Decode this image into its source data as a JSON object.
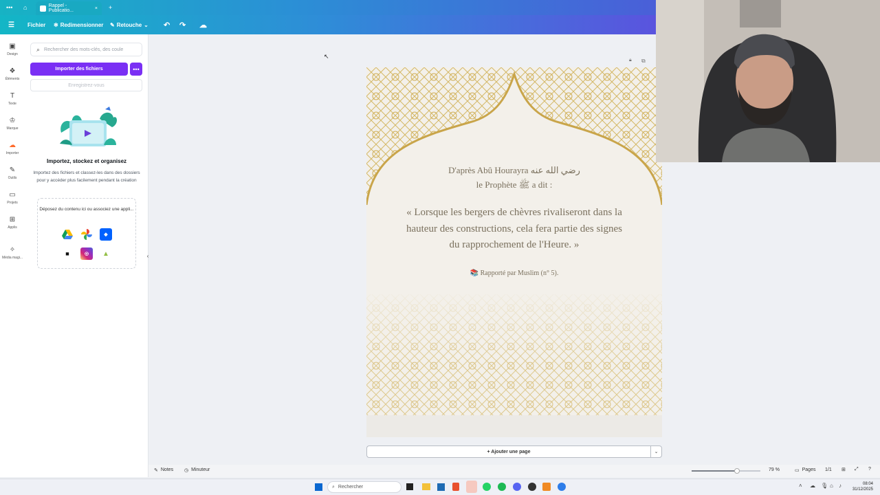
{
  "browser": {
    "tab_title": "Rappel - Publicatio...",
    "tab_close": "×",
    "new_tab": "+"
  },
  "toolbar": {
    "file": "Fichier",
    "resize": "Redimensionner",
    "edit": "Retouche"
  },
  "rail": {
    "items": [
      {
        "label": "Design",
        "icon": "layout-icon"
      },
      {
        "label": "Éléments",
        "icon": "shapes-icon"
      },
      {
        "label": "Texte",
        "icon": "text-icon"
      },
      {
        "label": "Marque",
        "icon": "brand-icon"
      },
      {
        "label": "Importer",
        "icon": "upload-cloud-icon"
      },
      {
        "label": "Outils",
        "icon": "pen-icon"
      },
      {
        "label": "Projets",
        "icon": "folder-icon"
      },
      {
        "label": "Applis",
        "icon": "apps-grid-icon"
      },
      {
        "label": "Média magi...",
        "icon": "magic-media-icon"
      }
    ]
  },
  "panel": {
    "search_placeholder": "Rechercher des mots-clés, des coule",
    "import_button": "Importer des fichiers",
    "record_button": "Enregistrez-vous",
    "title": "Importez, stockez et organisez",
    "description": "Importez des fichiers et classez-les dans des dossiers pour y accéder plus facilement pendant la création",
    "drop_text": "Déposez du contenu ici ou associez une appli...",
    "apps": [
      "Google Drive",
      "Google Photos",
      "Dropbox",
      "Notion",
      "Instagram",
      "Shopify"
    ]
  },
  "design": {
    "line1": "D'après Abû Hourayra رضي الله عنه",
    "line2": "le Prophète ﷺ a dit :",
    "quote1": "« Lorsque les bergers de chèvres rivaliseront dans la",
    "quote2": "hauteur des constructions, cela fera partie des signes",
    "quote3": "du rapprochement de l'Heure. »",
    "source": "📚 Rapporté par Muslim (n° 5)."
  },
  "canvas": {
    "add_page": "+ Ajouter une page"
  },
  "footer": {
    "notes": "Notes",
    "timer": "Minuteur",
    "zoom": "79 %",
    "zoom_fraction": 0.79,
    "pages_label": "Pages",
    "pages_count": "1/1"
  },
  "taskbar": {
    "search": "Rechercher",
    "time": "08:04",
    "date": "31/12/2025"
  },
  "colors": {
    "accent_purple": "#7a2ff4",
    "toolbar_start": "#13b6c6",
    "toolbar_end": "#5a54de",
    "gold": "#c9a54a"
  }
}
